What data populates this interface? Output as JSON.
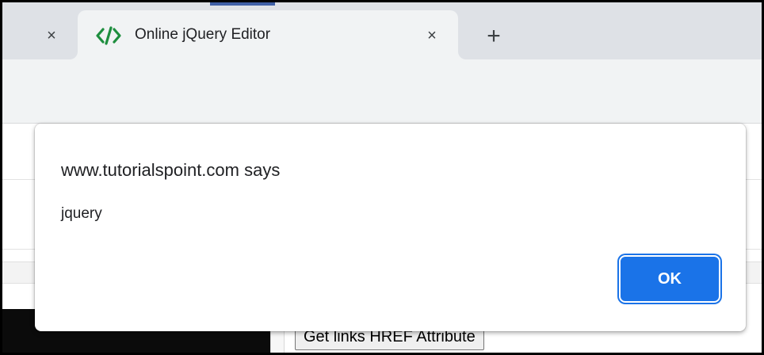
{
  "browser": {
    "tabs": [
      {
        "title": "Online jQuery Editor",
        "active": true
      }
    ],
    "close_glyph": "×",
    "new_tab_glyph": "+",
    "favicon": "code-brackets-icon",
    "favicon_color": "#1e8e3e"
  },
  "page": {
    "button_label": "Get links HREF Attribute"
  },
  "dialog": {
    "title": "www.tutorialspoint.com says",
    "message": "jquery",
    "ok_label": "OK",
    "accent_color": "#1a73e8"
  }
}
